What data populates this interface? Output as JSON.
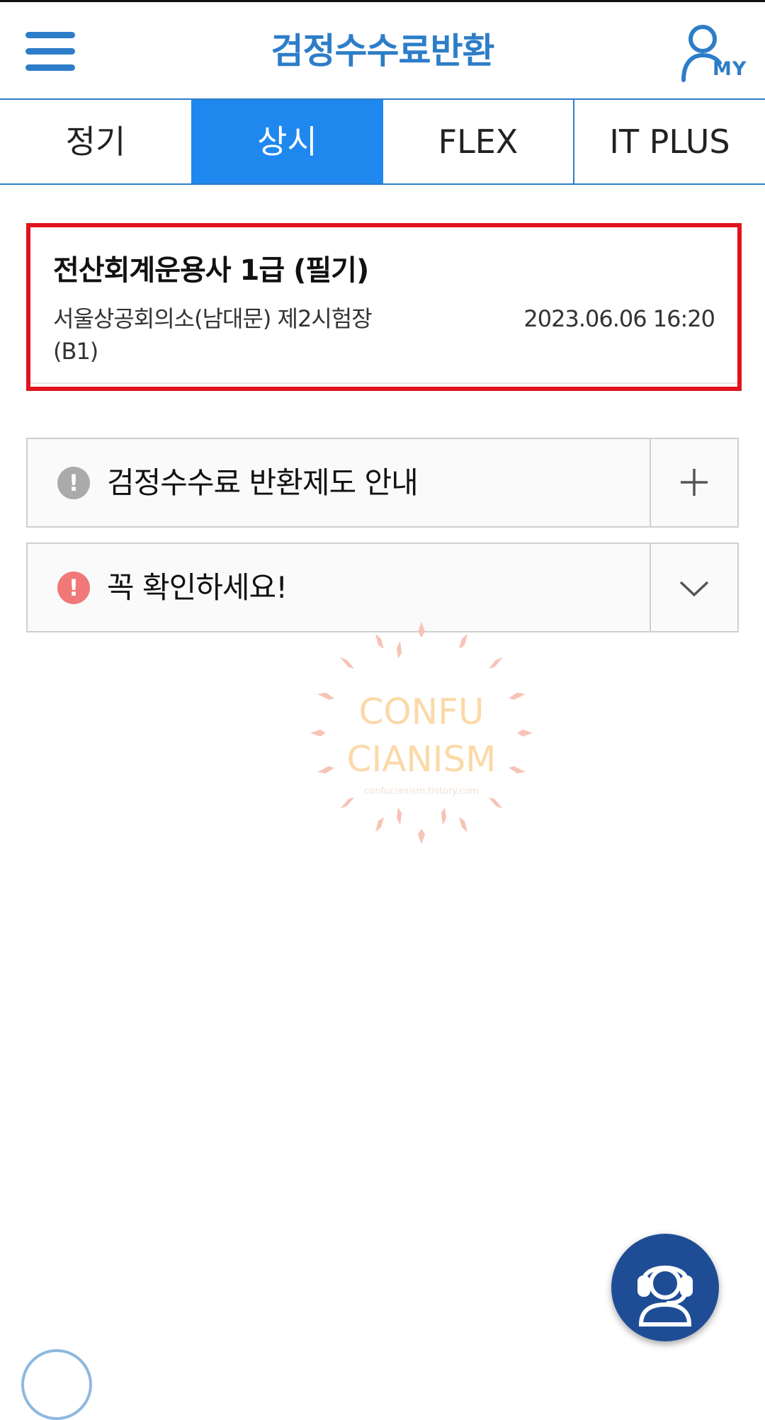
{
  "header": {
    "title": "검정수수료반환",
    "menu_icon": "hamburger-menu-icon",
    "my_label": "MY",
    "my_icon": "user-icon",
    "accent_color": "#2d7dc8"
  },
  "tabs": [
    {
      "label": "정기",
      "selected": false
    },
    {
      "label": "상시",
      "selected": true
    },
    {
      "label": "FLEX",
      "selected": false
    },
    {
      "label": "IT PLUS",
      "selected": false
    }
  ],
  "exam_card": {
    "name": "전산회계운용사 1급 (필기)",
    "place": "서울상공회의소(남대문)   제2시험장(B1)",
    "datetime": "2023.06.06 16:20",
    "highlight_color": "#e0141e"
  },
  "accordions": [
    {
      "title": "검정수수료 반환제도 안내",
      "icon": "info-exclamation-icon",
      "toggle_icon": "plus-icon"
    },
    {
      "title": "꼭 확인하세요!",
      "icon": "alert-exclamation-icon",
      "toggle_icon": "chevron-down-icon"
    }
  ],
  "watermark": {
    "line1": "CONFU",
    "line2": "CIANISM",
    "url": "confucianism.tistory.com"
  },
  "support": {
    "icon": "headset-support-icon",
    "color": "#1f4d95"
  }
}
